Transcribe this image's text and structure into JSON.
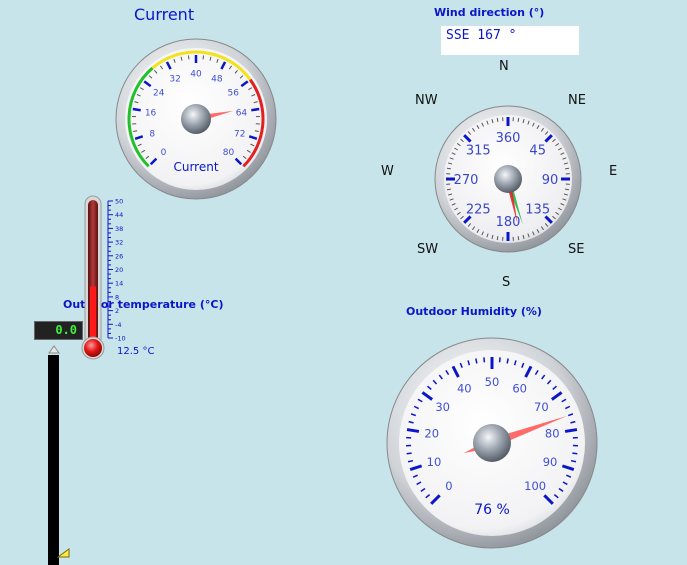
{
  "current": {
    "title": "Current",
    "scale_labels": [
      "0",
      "8",
      "16",
      "24",
      "32",
      "40",
      "48",
      "56",
      "64",
      "72",
      "80"
    ],
    "dial_label": "Current",
    "value": 63
  },
  "wind": {
    "title": "Wind direction (°)",
    "readout": "SSE  167 °",
    "compass": {
      "n": "N",
      "ne": "NE",
      "e": "E",
      "se": "SE",
      "s": "S",
      "sw": "SW",
      "w": "W",
      "nw": "NW"
    },
    "dial_labels": [
      "360",
      "45",
      "90",
      "135",
      "180",
      "225",
      "270",
      "315"
    ],
    "direction_deg": 167
  },
  "temperature": {
    "title": "Outdoor temperature (°C)",
    "lcd_value": "0.0",
    "scale_labels": [
      "50",
      "44",
      "38",
      "32",
      "26",
      "20",
      "14",
      "8",
      "2",
      "-4",
      "-10"
    ],
    "value_label": "12.5 °C",
    "value": 12.5
  },
  "humidity": {
    "title": "Outdoor Humidity (%)",
    "scale_labels": [
      "0",
      "10",
      "20",
      "30",
      "40",
      "50",
      "60",
      "70",
      "80",
      "90",
      "100"
    ],
    "readout": "76 %",
    "value": 76
  },
  "colors": {
    "background": "#c7e4ea",
    "title_blue": "#0a16c8",
    "needle_red": "#e32222",
    "needle_green": "#22b84a",
    "lcd_green": "#3cf23c"
  }
}
